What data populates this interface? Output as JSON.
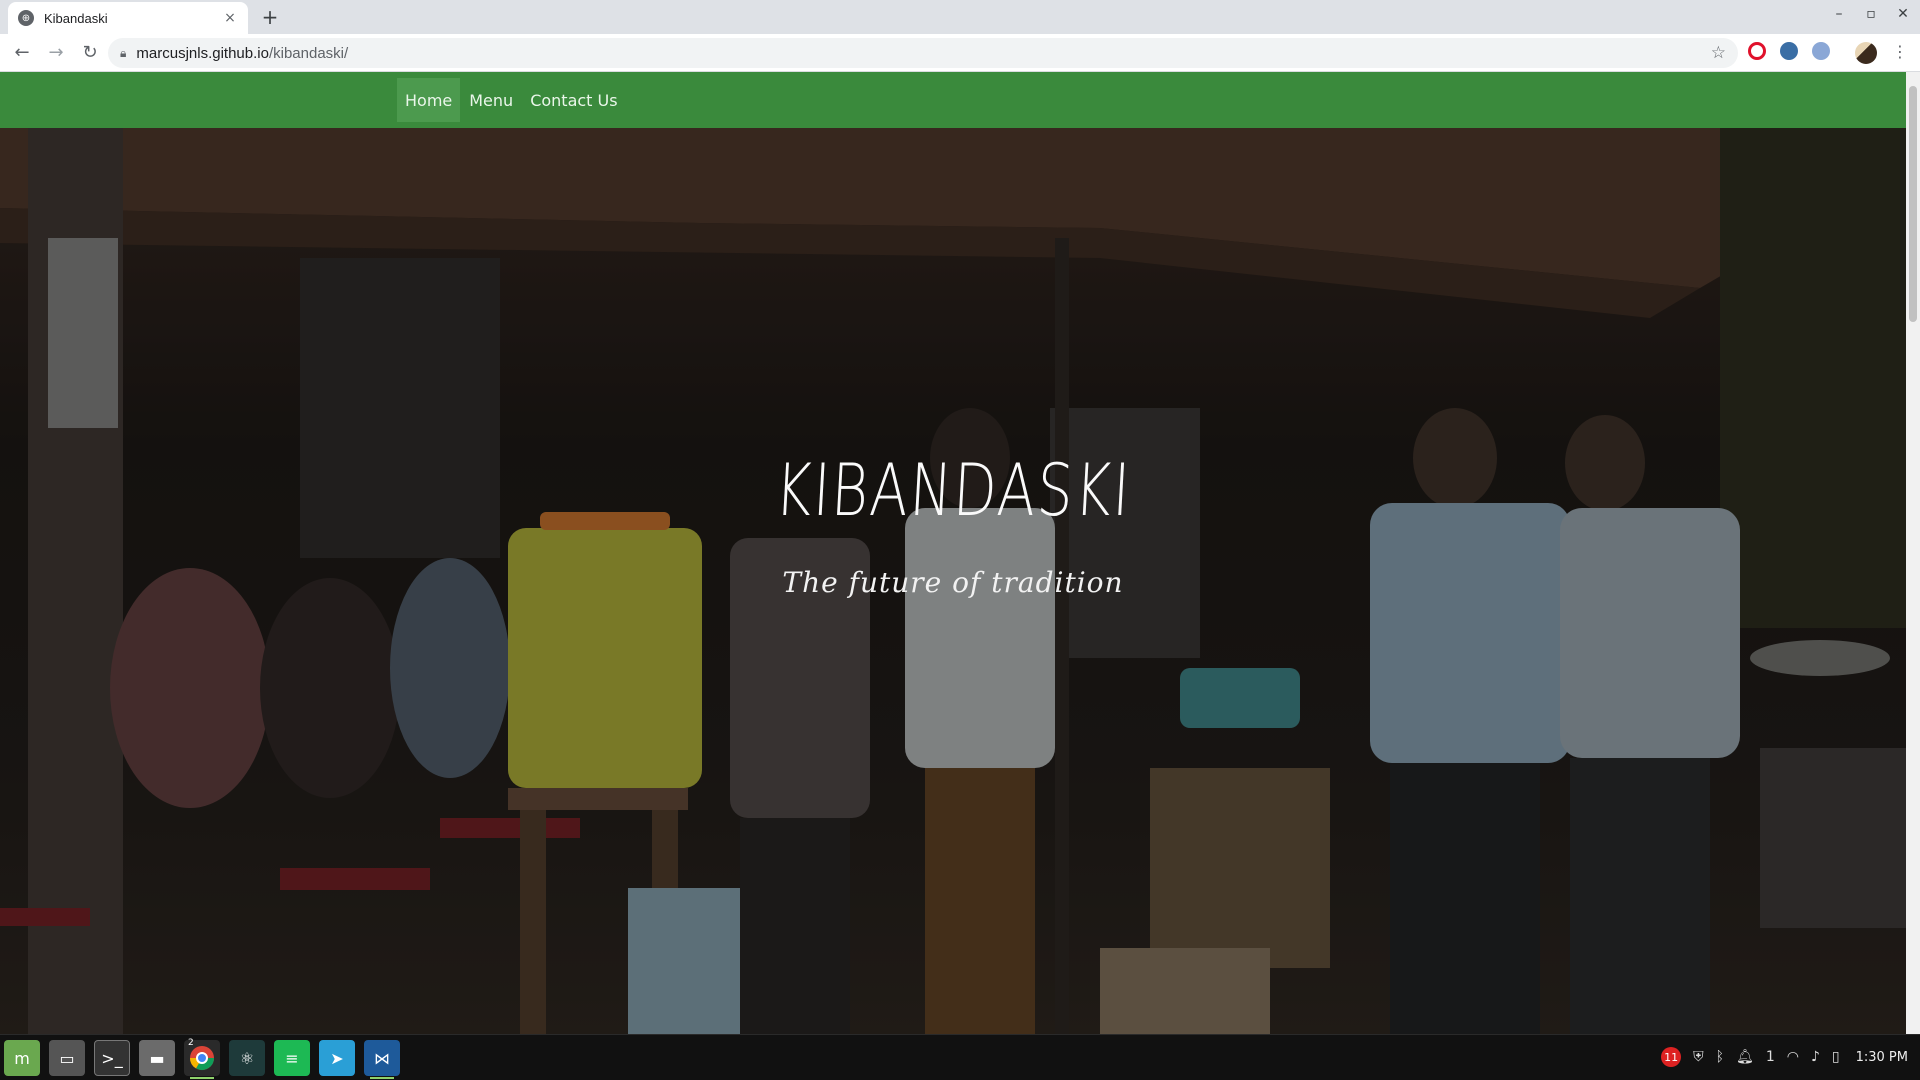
{
  "browser": {
    "tab_title": "Kibandaski",
    "tab_close": "×",
    "new_tab": "+",
    "url_host": "marcusjnls.github.io",
    "url_path": "/kibandaski/",
    "window_controls": [
      "–",
      "▫",
      "✕"
    ]
  },
  "site": {
    "nav": {
      "home": "Home",
      "menu": "Menu",
      "contact": "Contact Us"
    },
    "hero": {
      "title": "KIBANDASKI",
      "tagline": "The future of tradition"
    }
  },
  "taskbar": {
    "chrome_badge": "2",
    "tray_badge": "11",
    "tray_count": "1",
    "clock": "1:30 PM"
  },
  "colors": {
    "nav_green": "#3a8a3c",
    "nav_active": "#4c9a4e"
  }
}
